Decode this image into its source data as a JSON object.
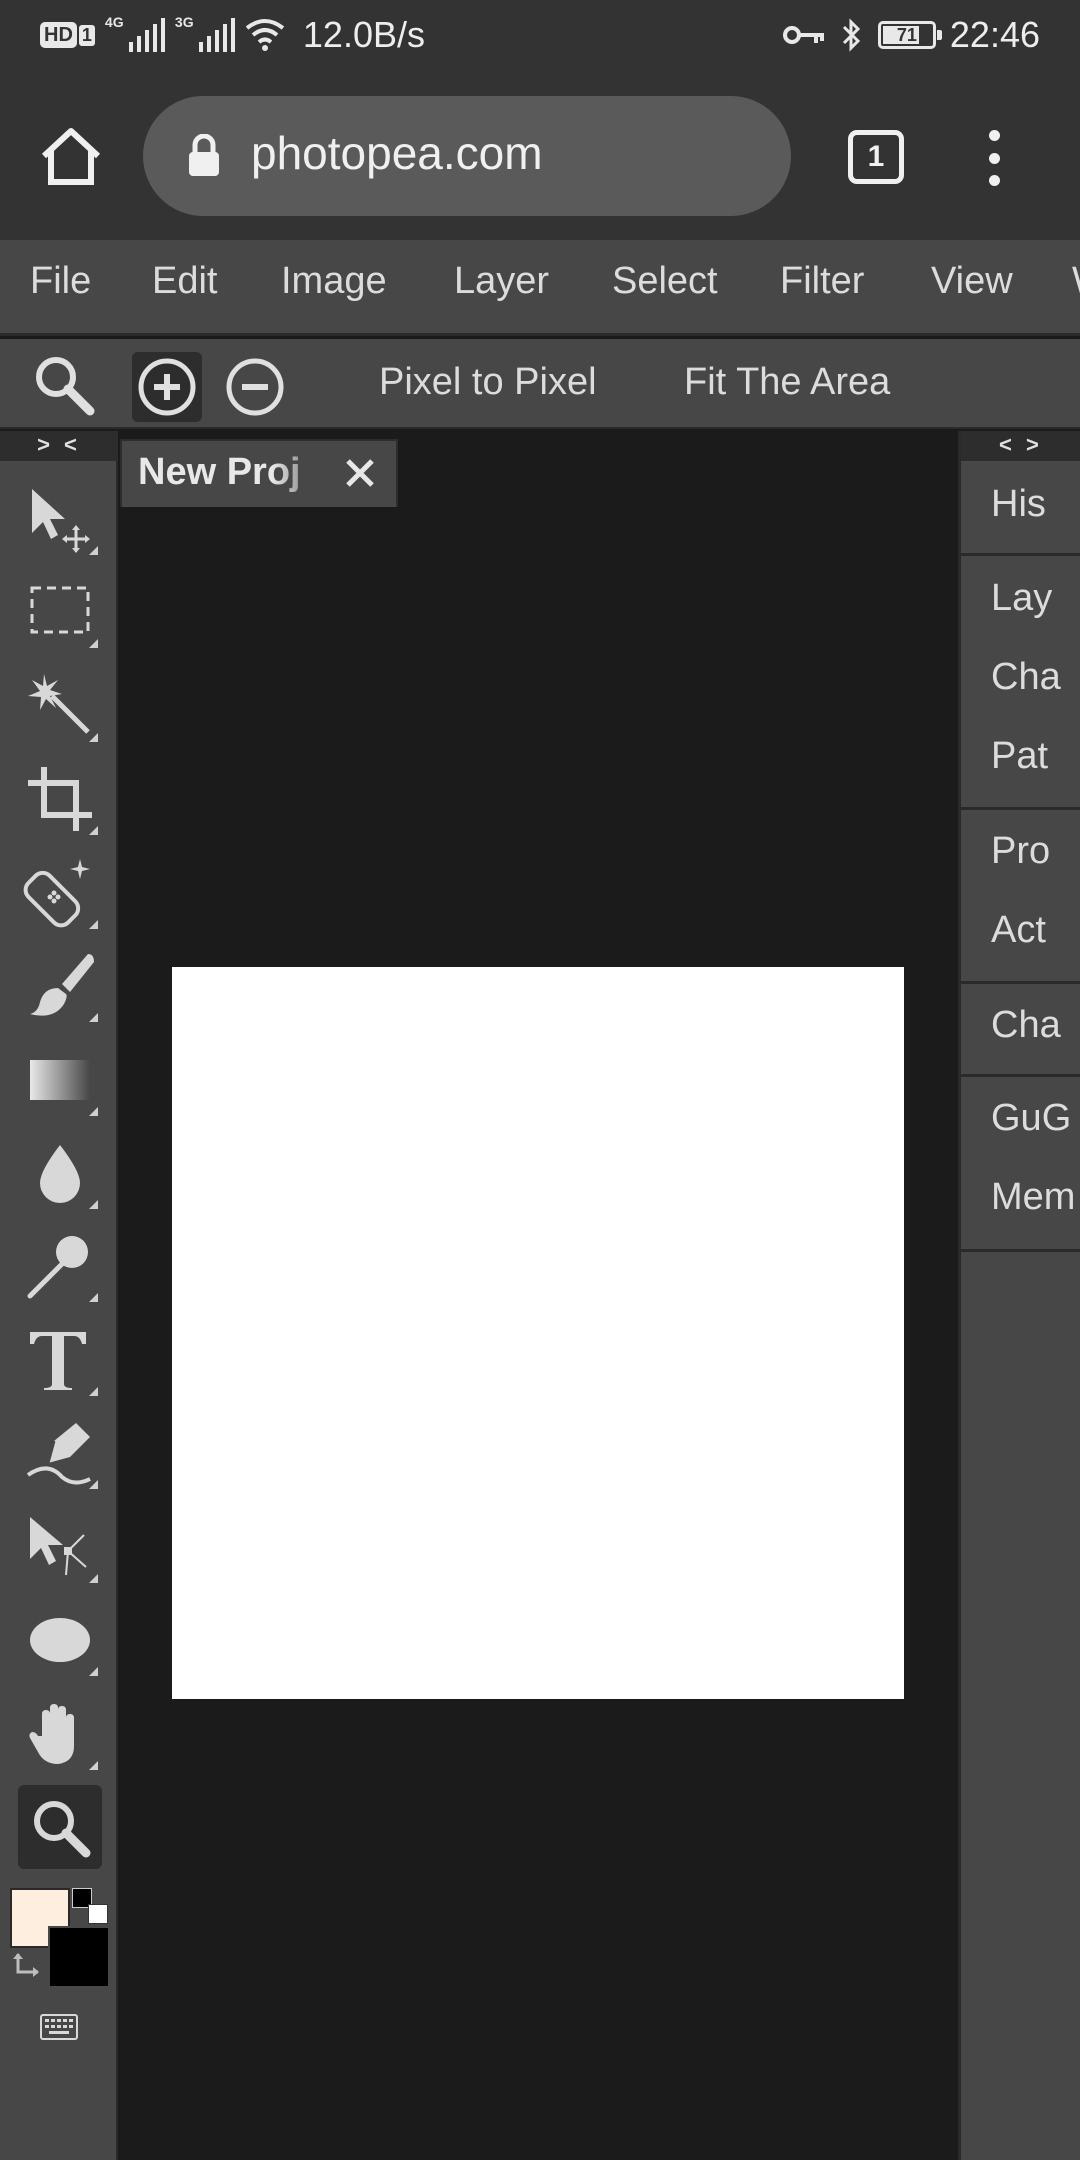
{
  "status_bar": {
    "hd": "HD",
    "sim1": "1",
    "net1": "4G",
    "net2": "3G",
    "speed": "12.0B/s",
    "battery": "71",
    "time": "22:46"
  },
  "browser": {
    "url": "photopea.com",
    "tab_count": "1"
  },
  "menu": {
    "items": [
      "File",
      "Edit",
      "Image",
      "Layer",
      "Select",
      "Filter",
      "View",
      "W"
    ]
  },
  "options_bar": {
    "pixel_to_pixel": "Pixel to Pixel",
    "fit_area": "Fit The Area"
  },
  "toolbar": {
    "collapse": "> <",
    "tools": [
      "move-tool",
      "marquee-tool",
      "magic-wand-tool",
      "crop-tool",
      "healing-tool",
      "brush-tool",
      "gradient-tool",
      "blur-tool",
      "dodge-tool",
      "type-tool",
      "pen-tool",
      "path-select-tool",
      "ellipse-tool",
      "hand-tool",
      "zoom-tool"
    ],
    "foreground_color": "#fdeee0",
    "background_color": "#000000"
  },
  "document": {
    "tab_label": "New Proj",
    "canvas_color": "#ffffff"
  },
  "right_panel": {
    "collapse": "< >",
    "items": [
      "His",
      "Lay",
      "Cha",
      "Pat",
      "Pro",
      "Act",
      "Cha",
      "GuG",
      "Mem"
    ]
  }
}
